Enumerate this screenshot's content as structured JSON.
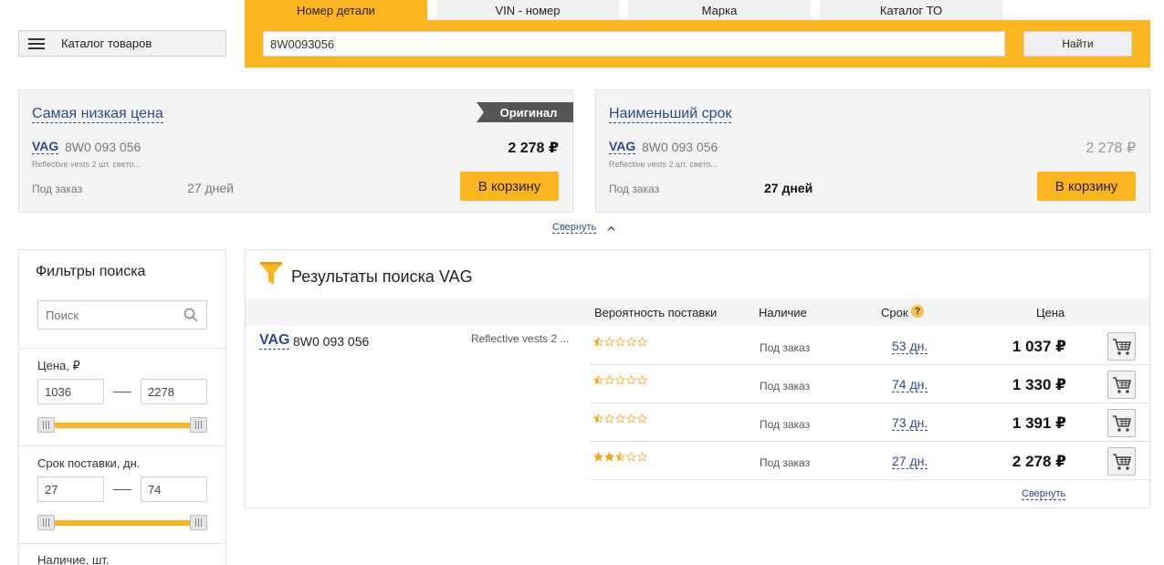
{
  "header": {
    "catalog_label": "Каталог товаров",
    "tabs": [
      "Номер детали",
      "VIN - номер",
      "Марка",
      "Каталог ТО"
    ],
    "search_value": "8W0093056",
    "find_label": "Найти"
  },
  "offers": [
    {
      "title": "Самая низкая цена",
      "badge": "Оригинал",
      "brand": "VAG",
      "code": "8W0 093 056",
      "desc": "Reflective vests 2 шт. свето...",
      "price": "2 278 ₽",
      "availability": "Под заказ",
      "days": "27 дней",
      "cart_label": "В корзину"
    },
    {
      "title": "Наименьший срок",
      "brand": "VAG",
      "code": "8W0 093 056",
      "desc": "Reflective vests 2 шт. свето...",
      "price": "2 278 ₽",
      "availability": "Под заказ",
      "days": "27 дней",
      "cart_label": "В корзину"
    }
  ],
  "collapse_label": "Свернуть",
  "filters": {
    "title": "Фильтры поиска",
    "search_placeholder": "Поиск",
    "price_label": "Цена, ₽",
    "price_min": "1036",
    "price_max": "2278",
    "delivery_label": "Срок поставки, дн.",
    "delivery_min": "27",
    "delivery_max": "74",
    "stock_label": "Наличие, шт."
  },
  "results": {
    "title": "Результаты поиска VAG",
    "columns": {
      "probability": "Вероятность поставки",
      "availability": "Наличие",
      "term": "Срок",
      "price": "Цена"
    },
    "help_icon": "?",
    "brand": "VAG",
    "code": "8W0 093 056",
    "desc": "Reflective vests 2 ...",
    "rows": [
      {
        "rating": 0.5,
        "availability": "Под заказ",
        "days": "53 дн.",
        "price": "1 037 ₽"
      },
      {
        "rating": 0.5,
        "availability": "Под заказ",
        "days": "74 дн.",
        "price": "1 330 ₽"
      },
      {
        "rating": 0.5,
        "availability": "Под заказ",
        "days": "73 дн.",
        "price": "1 391 ₽"
      },
      {
        "rating": 2.5,
        "availability": "Под заказ",
        "days": "27 дн.",
        "price": "2 278 ₽"
      }
    ],
    "collapse_label": "Свернуть"
  },
  "colors": {
    "accent": "#fbb51f",
    "link": "#2d4a8a",
    "badge": "#555555"
  }
}
